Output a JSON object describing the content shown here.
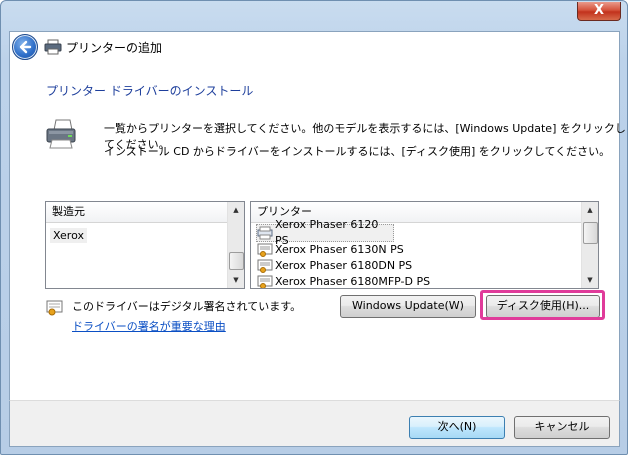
{
  "window": {
    "title": "プリンターの追加",
    "close_label": "X"
  },
  "page": {
    "heading": "プリンター ドライバーのインストール",
    "desc_line1": "一覧からプリンターを選択してください。他のモデルを表示するには、[Windows Update] をクリックしてください。",
    "desc_line2": "インストール CD からドライバーをインストールするには、[ディスク使用] をクリックしてください。"
  },
  "manufacturers": {
    "header": "製造元",
    "items": [
      "Xerox"
    ]
  },
  "printers": {
    "header": "プリンター",
    "items": [
      "Xerox Phaser 6120 PS",
      "Xerox Phaser 6130N PS",
      "Xerox Phaser 6180DN PS",
      "Xerox Phaser 6180MFP-D PS"
    ]
  },
  "signature": {
    "text": "このドライバーはデジタル署名されています。",
    "link": "ドライバーの署名が重要な理由"
  },
  "buttons": {
    "windows_update": "Windows Update(W)",
    "have_disk": "ディスク使用(H)...",
    "next": "次へ(N)",
    "cancel": "キャンセル"
  },
  "colors": {
    "highlight": "#e03b9a",
    "heading": "#1e3f9c",
    "link": "#0b4fc4"
  }
}
